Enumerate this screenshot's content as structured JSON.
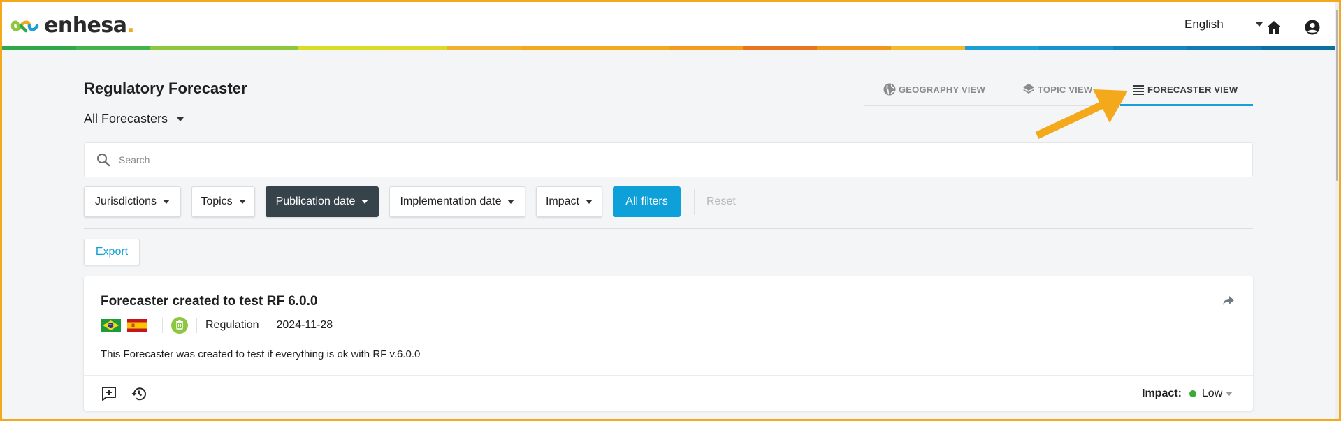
{
  "header": {
    "brand": "enhesa",
    "brand_dot": ".",
    "language": "English",
    "rainbow_colors": [
      "#2ea84a",
      "#45b34b",
      "#8dc63f",
      "#8dc63f",
      "#d6de23",
      "#dcd92a",
      "#f0b22d",
      "#f4a81c",
      "#f4a81c",
      "#f39c1d",
      "#e8741d",
      "#f0961c",
      "#f4ba2b",
      "#1a9fd9",
      "#1792d0",
      "#1585c2",
      "#117bb2",
      "#0d6ea0"
    ]
  },
  "page": {
    "title": "Regulatory Forecaster",
    "scope_label": "All Forecasters"
  },
  "views": [
    {
      "label": "GEOGRAPHY VIEW",
      "icon": "globe-icon"
    },
    {
      "label": "TOPIC VIEW",
      "icon": "layers-icon"
    },
    {
      "label": "FORECASTER VIEW",
      "icon": "list-icon",
      "active": true
    }
  ],
  "search": {
    "placeholder": "Search"
  },
  "filters": {
    "jurisdictions": "Jurisdictions",
    "topics": "Topics",
    "publication_date": "Publication date",
    "implementation_date": "Implementation date",
    "impact": "Impact",
    "all_filters": "All filters",
    "reset": "Reset"
  },
  "export_label": "Export",
  "card": {
    "title": "Forecaster created to test RF 6.0.0",
    "flags": [
      "brazil-flag",
      "spain-flag"
    ],
    "type": "Regulation",
    "date": "2024-11-28",
    "description": "This Forecaster was created to test if everything is ok with RF v.6.0.0",
    "impact_label": "Impact:",
    "impact_value": "Low",
    "impact_color": "#3aaa35"
  },
  "colors": {
    "accent": "#0ea0d8",
    "dark_filter": "#37434b",
    "annotation_arrow": "#f4a81c"
  }
}
